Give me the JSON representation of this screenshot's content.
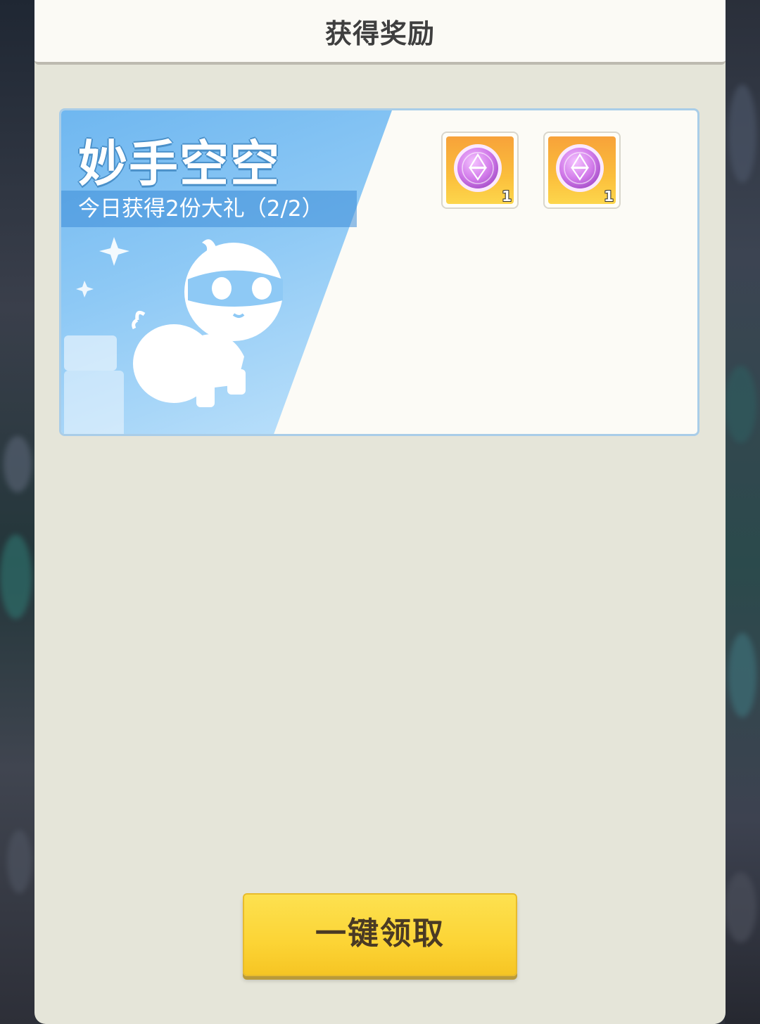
{
  "dialog": {
    "title": "获得奖励"
  },
  "reward_card": {
    "title": "妙手空空",
    "subtitle": "今日获得2份大礼（2/2）",
    "items": [
      {
        "icon": "star-coin-icon",
        "count": "1"
      },
      {
        "icon": "star-coin-icon",
        "count": "1"
      }
    ]
  },
  "claim_button": {
    "label": "一键领取"
  },
  "colors": {
    "panel_bg": "#e5e5d9",
    "header_bg": "#fbfaf5",
    "card_blue": "#6fb7f0",
    "button_yellow": "#fcd435",
    "coin_purple": "#c772e8"
  }
}
